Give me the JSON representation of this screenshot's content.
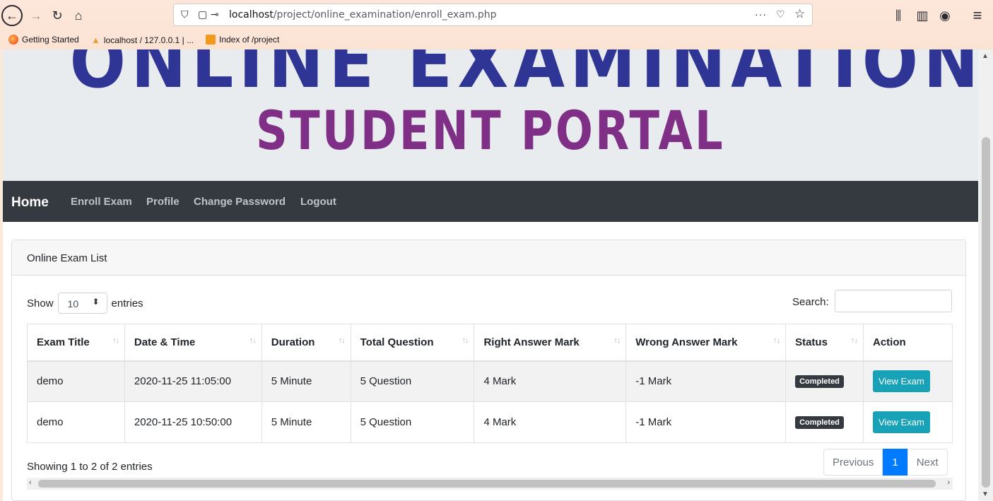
{
  "browser": {
    "url_host": "localhost",
    "url_path": "/project/online_examination/enroll_exam.php",
    "bookmarks": [
      "Getting Started",
      "localhost / 127.0.0.1 | ...",
      "Index of /project"
    ],
    "icons": {
      "back": "←",
      "forward": "→",
      "reload": "↻",
      "home": "⌂",
      "more": "···",
      "pocket": "♡",
      "star": "☆",
      "library": "⫼",
      "sidebar": "▥",
      "account": "◉",
      "menu": "≡"
    }
  },
  "banner": {
    "title": "ONLINE EXAMINATION SYSTEM",
    "subtitle": "STUDENT PORTAL"
  },
  "nav": {
    "brand": "Home",
    "links": [
      "Enroll Exam",
      "Profile",
      "Change Password",
      "Logout"
    ]
  },
  "card": {
    "title": "Online Exam List",
    "show_label": "Show",
    "entries_value": "10",
    "entries_label": "entries",
    "search_label": "Search:",
    "search_value": ""
  },
  "table": {
    "headers": [
      "Exam Title",
      "Date & Time",
      "Duration",
      "Total Question",
      "Right Answer Mark",
      "Wrong Answer Mark",
      "Status",
      "Action"
    ],
    "rows": [
      [
        "demo",
        "2020-11-25 11:05:00",
        "5 Minute",
        "5 Question",
        "4 Mark",
        "-1 Mark",
        "Completed",
        "View Exam"
      ],
      [
        "demo",
        "2020-11-25 10:50:00",
        "5 Minute",
        "5 Question",
        "4 Mark",
        "-1 Mark",
        "Completed",
        "View Exam"
      ]
    ]
  },
  "footer": {
    "showing": "Showing 1 to 2 of 2 entries",
    "previous": "Previous",
    "page": "1",
    "next": "Next"
  },
  "colors": {
    "banner_title": "#2e3594",
    "banner_subtitle": "#7f2f86",
    "navbar": "#343a40",
    "view_button": "#17a2b8",
    "page_active": "#007bff"
  }
}
